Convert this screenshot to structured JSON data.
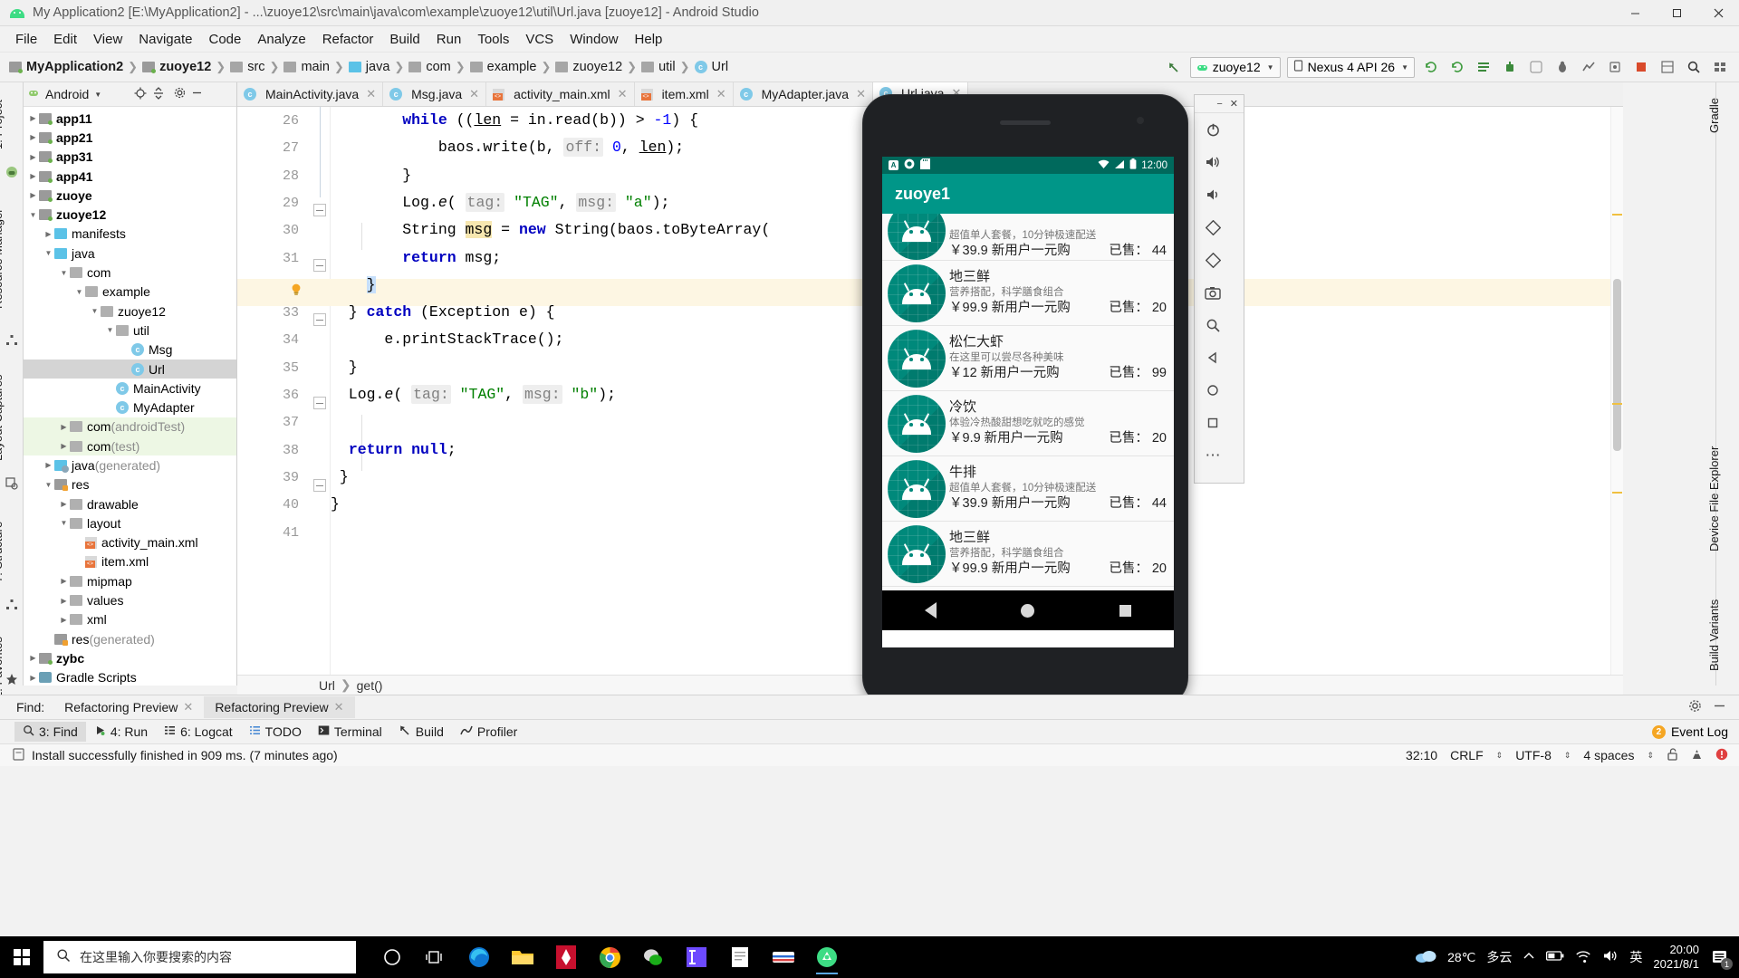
{
  "titlebar": {
    "title": "My Application2 [E:\\MyApplication2] - ...\\zuoye12\\src\\main\\java\\com\\example\\zuoye12\\util\\Url.java [zuoye12] - Android Studio",
    "minimize": "–",
    "maximize": "▢",
    "close": "✕"
  },
  "menu": [
    "File",
    "Edit",
    "View",
    "Navigate",
    "Code",
    "Analyze",
    "Refactor",
    "Build",
    "Run",
    "Tools",
    "VCS",
    "Window",
    "Help"
  ],
  "breadcrumb": [
    {
      "label": "MyApplication2",
      "icon": "module-folder-icon",
      "bold": true
    },
    {
      "label": "zuoye12",
      "icon": "module-folder-icon",
      "bold": true
    },
    {
      "label": "src",
      "icon": "folder-icon",
      "bold": false
    },
    {
      "label": "main",
      "icon": "folder-icon",
      "bold": false
    },
    {
      "label": "java",
      "icon": "source-folder-icon",
      "bold": false
    },
    {
      "label": "com",
      "icon": "package-icon",
      "bold": false
    },
    {
      "label": "example",
      "icon": "package-icon",
      "bold": false
    },
    {
      "label": "zuoye12",
      "icon": "package-icon",
      "bold": false
    },
    {
      "label": "util",
      "icon": "package-icon",
      "bold": false
    },
    {
      "label": "Url",
      "icon": "java-class-icon",
      "bold": false
    }
  ],
  "toolbar": {
    "run_config": "zuoye12",
    "device": "Nexus 4 API 26",
    "icons": [
      "back-arrow-icon",
      "sync-icon",
      "sync-project-icon",
      "avd-manager-icon",
      "sdk-manager-icon",
      "run-icon",
      "debug-icon",
      "profile-icon",
      "attach-debugger-icon",
      "stop-icon",
      "layout-inspector-icon",
      "search-everywhere-icon",
      "project-structure-icon"
    ]
  },
  "left_rail": [
    "1: Project",
    "Resource Manager",
    "Layout Captures",
    "7: Structure",
    "2: Favorites"
  ],
  "right_rail": [
    "Gradle",
    "Device File Explorer",
    "Build Variants"
  ],
  "project_panel": {
    "selector": "Android",
    "header_icons": [
      "locate-icon",
      "collapse-all-icon",
      "settings-icon",
      "hide-icon"
    ],
    "tree": [
      {
        "label": "app11",
        "depth": 0,
        "arrow": "collapsed",
        "icon": "module-folder-icon",
        "bold": true
      },
      {
        "label": "app21",
        "depth": 0,
        "arrow": "collapsed",
        "icon": "module-folder-icon",
        "bold": true
      },
      {
        "label": "app31",
        "depth": 0,
        "arrow": "collapsed",
        "icon": "module-folder-icon",
        "bold": true
      },
      {
        "label": "app41",
        "depth": 0,
        "arrow": "collapsed",
        "icon": "module-folder-icon",
        "bold": true
      },
      {
        "label": "zuoye",
        "depth": 0,
        "arrow": "collapsed",
        "icon": "module-folder-icon",
        "bold": true
      },
      {
        "label": "zuoye12",
        "depth": 0,
        "arrow": "expanded",
        "icon": "module-folder-icon",
        "bold": true
      },
      {
        "label": "manifests",
        "depth": 1,
        "arrow": "collapsed",
        "icon": "source-folder-icon",
        "bold": false
      },
      {
        "label": "java",
        "depth": 1,
        "arrow": "expanded",
        "icon": "source-folder-icon",
        "bold": false
      },
      {
        "label": "com",
        "depth": 2,
        "arrow": "expanded",
        "icon": "package-icon",
        "bold": false
      },
      {
        "label": "example",
        "depth": 3,
        "arrow": "expanded",
        "icon": "package-icon",
        "bold": false
      },
      {
        "label": "zuoye12",
        "depth": 4,
        "arrow": "expanded",
        "icon": "package-icon",
        "bold": false
      },
      {
        "label": "util",
        "depth": 5,
        "arrow": "expanded",
        "icon": "package-icon",
        "bold": false
      },
      {
        "label": "Msg",
        "depth": 6,
        "arrow": "none",
        "icon": "java-class-icon",
        "bold": false
      },
      {
        "label": "Url",
        "depth": 6,
        "arrow": "none",
        "icon": "java-class-icon",
        "bold": false,
        "selected": true
      },
      {
        "label": "MainActivity",
        "depth": 5,
        "arrow": "none",
        "icon": "java-class-icon",
        "bold": false
      },
      {
        "label": "MyAdapter",
        "depth": 5,
        "arrow": "none",
        "icon": "java-class-icon",
        "bold": false
      },
      {
        "label": "com",
        "suffix": " (androidTest)",
        "depth": 2,
        "arrow": "collapsed",
        "icon": "package-icon",
        "bold": false,
        "test": true
      },
      {
        "label": "com",
        "suffix": " (test)",
        "depth": 2,
        "arrow": "collapsed",
        "icon": "package-icon",
        "bold": false,
        "test": true
      },
      {
        "label": "java",
        "suffix": " (generated)",
        "depth": 1,
        "arrow": "collapsed",
        "icon": "generated-folder-icon",
        "bold": false
      },
      {
        "label": "res",
        "depth": 1,
        "arrow": "expanded",
        "icon": "res-folder-icon",
        "bold": false
      },
      {
        "label": "drawable",
        "depth": 2,
        "arrow": "collapsed",
        "icon": "package-icon",
        "bold": false
      },
      {
        "label": "layout",
        "depth": 2,
        "arrow": "expanded",
        "icon": "package-icon",
        "bold": false
      },
      {
        "label": "activity_main.xml",
        "depth": 3,
        "arrow": "none",
        "icon": "xml-layout-icon",
        "bold": false
      },
      {
        "label": "item.xml",
        "depth": 3,
        "arrow": "none",
        "icon": "xml-layout-icon",
        "bold": false
      },
      {
        "label": "mipmap",
        "depth": 2,
        "arrow": "collapsed",
        "icon": "package-icon",
        "bold": false
      },
      {
        "label": "values",
        "depth": 2,
        "arrow": "collapsed",
        "icon": "package-icon",
        "bold": false
      },
      {
        "label": "xml",
        "depth": 2,
        "arrow": "collapsed",
        "icon": "package-icon",
        "bold": false
      },
      {
        "label": "res",
        "suffix": " (generated)",
        "depth": 1,
        "arrow": "none",
        "icon": "res-folder-icon",
        "bold": false
      },
      {
        "label": "zybc",
        "depth": 0,
        "arrow": "collapsed",
        "icon": "module-folder-icon",
        "bold": true
      },
      {
        "label": "Gradle Scripts",
        "depth": 0,
        "arrow": "collapsed",
        "icon": "gradle-icon",
        "bold": false
      }
    ]
  },
  "editor": {
    "tabs": [
      {
        "label": "MainActivity.java",
        "icon": "java-class-icon",
        "active": false
      },
      {
        "label": "Msg.java",
        "icon": "java-class-icon",
        "active": false
      },
      {
        "label": "activity_main.xml",
        "icon": "xml-layout-icon",
        "active": false
      },
      {
        "label": "item.xml",
        "icon": "xml-layout-icon",
        "active": false
      },
      {
        "label": "MyAdapter.java",
        "icon": "java-class-icon",
        "active": false
      },
      {
        "label": "Url.java",
        "icon": "java-class-icon",
        "active": true
      }
    ],
    "first_line_number": 26,
    "line_numbers": [
      26,
      27,
      28,
      29,
      30,
      31,
      32,
      33,
      34,
      35,
      36,
      37,
      38,
      39,
      40,
      41
    ],
    "highlight_line": 32,
    "breadcrumb": [
      "Url",
      "get()"
    ],
    "code_lines": [
      {
        "n": 26,
        "html": "        <span class=\"kw\">while</span> ((<span class=\"ul\">len</span> = in.read(b)) &gt; <span class=\"num\">-1</span>) {"
      },
      {
        "n": 27,
        "html": "            baos.write(b, <span class=\"hint\">off:</span> <span class=\"num\">0</span>, <span class=\"ul\">len</span>);"
      },
      {
        "n": 28,
        "html": "        }"
      },
      {
        "n": 29,
        "html": "        Log.<span class=\"ital\">e</span>( <span class=\"hint\">tag:</span> <span class=\"str\">\"TAG\"</span>, <span class=\"hint\">msg:</span> <span class=\"str\">\"a\"</span>);"
      },
      {
        "n": 30,
        "html": "        String <span class=\"occur\">msg</span> = <span class=\"kw\">new</span> String(baos.toByteArray("
      },
      {
        "n": 31,
        "html": "        <span class=\"kw\">return</span> msg;"
      },
      {
        "n": 32,
        "html": "    <span class=\"caretsel\">}</span>"
      },
      {
        "n": 33,
        "html": "  } <span class=\"kw\">catch</span> (Exception e) {"
      },
      {
        "n": 34,
        "html": "      e.printStackTrace();"
      },
      {
        "n": 35,
        "html": "  }"
      },
      {
        "n": 36,
        "html": "  Log.<span class=\"ital\">e</span>( <span class=\"hint\">tag:</span> <span class=\"str\">\"TAG\"</span>, <span class=\"hint\">msg:</span> <span class=\"str\">\"b\"</span>);"
      },
      {
        "n": 37,
        "html": ""
      },
      {
        "n": 38,
        "html": "  <span class=\"kw\">return</span> <span class=\"kw\">null</span>;"
      },
      {
        "n": 39,
        "html": " }"
      },
      {
        "n": 40,
        "html": "}"
      },
      {
        "n": 41,
        "html": ""
      }
    ]
  },
  "emulator": {
    "window_icons": [
      "minimize-icon",
      "close-icon",
      "power-icon",
      "volume-up-icon",
      "volume-down-icon",
      "rotate-left-icon",
      "rotate-right-icon",
      "screenshot-icon",
      "zoom-icon",
      "back-icon",
      "home-icon",
      "overview-icon",
      "more-icon"
    ],
    "status_bar": {
      "left_icons": [
        "alarm-icon",
        "record-icon",
        "sdcard-icon"
      ],
      "wifi": "wifi-icon",
      "signal": "signal-icon",
      "battery": "battery-icon",
      "time": "12:00"
    },
    "app_title": "zuoye1",
    "list_items": [
      {
        "title": "",
        "desc": "超值单人套餐，10分钟极速配送",
        "price": "￥39.9 新用户一元购",
        "sold": "已售： 44",
        "partial": true
      },
      {
        "title": "地三鲜",
        "desc": "营养搭配，科学膳食组合",
        "price": "￥99.9 新用户一元购",
        "sold": "已售： 20"
      },
      {
        "title": "松仁大虾",
        "desc": "在这里可以尝尽各种美味",
        "price": "￥12 新用户一元购",
        "sold": "已售： 99"
      },
      {
        "title": "冷饮",
        "desc": "体验冷热酸甜想吃就吃的感觉",
        "price": "￥9.9 新用户一元购",
        "sold": "已售： 20"
      },
      {
        "title": "牛排",
        "desc": "超值单人套餐，10分钟极速配送",
        "price": "￥39.9 新用户一元购",
        "sold": "已售： 44"
      },
      {
        "title": "地三鲜",
        "desc": "营养搭配，科学膳食组合",
        "price": "￥99.9 新用户一元购",
        "sold": "已售： 20"
      }
    ],
    "nav_buttons": [
      "back-button",
      "home-button",
      "recents-button"
    ]
  },
  "find_panel": {
    "label": "Find:",
    "tabs": [
      {
        "label": "Refactoring Preview",
        "active": false
      },
      {
        "label": "Refactoring Preview",
        "active": true
      }
    ],
    "right_icons": [
      "settings-icon",
      "hide-icon"
    ]
  },
  "tool_windows": [
    {
      "label": "3: Find",
      "icon": "search-icon",
      "active": true
    },
    {
      "label": "4: Run",
      "icon": "run-icon",
      "active": false
    },
    {
      "label": "6: Logcat",
      "icon": "logcat-icon",
      "active": false
    },
    {
      "label": "TODO",
      "icon": "todo-icon",
      "active": false
    },
    {
      "label": "Terminal",
      "icon": "terminal-icon",
      "active": false
    },
    {
      "label": "Build",
      "icon": "build-icon",
      "active": false
    },
    {
      "label": "Profiler",
      "icon": "profiler-icon",
      "active": false
    }
  ],
  "event_log": {
    "label": "Event Log",
    "badge": "2"
  },
  "status_bar": {
    "message": "Install successfully finished in 909 ms. (7 minutes ago)",
    "message_icon": "info-icon",
    "caret": "32:10",
    "line_sep": "CRLF",
    "encoding": "UTF-8",
    "indent": "4 spaces",
    "lock_icon": "unlock-icon",
    "inspect_icon": "inspection-icon",
    "error_icon": "error-icon"
  },
  "taskbar": {
    "start_icon": "windows-start-icon",
    "search_placeholder": "在这里输入你要搜索的内容",
    "search_icon": "search-icon",
    "apps": [
      {
        "name": "cortana-icon"
      },
      {
        "name": "task-view-icon"
      },
      {
        "name": "edge-icon"
      },
      {
        "name": "file-explorer-icon"
      },
      {
        "name": "red-app-icon"
      },
      {
        "name": "chrome-icon"
      },
      {
        "name": "wechat-icon"
      },
      {
        "name": "intellij-icon"
      },
      {
        "name": "notepad-icon"
      },
      {
        "name": "browser-icon"
      },
      {
        "name": "android-studio-icon",
        "active": true
      }
    ],
    "weather": {
      "icon": "cloud-icon",
      "temp": "28℃",
      "desc": "多云"
    },
    "tray_icons": [
      "chevron-up-icon",
      "battery-icon",
      "wifi-icon",
      "volume-icon"
    ],
    "ime": "英",
    "time": "20:00",
    "date": "2021/8/1",
    "notification_icon": "notification-icon",
    "notification_count": "1"
  },
  "colors": {
    "accent": "#009688",
    "status_bar_dark": "#00695c",
    "tab_active": "#4a89c8",
    "highlight_line": "#fdf6e3",
    "selection": "#c6dffb",
    "occurrence": "#f7e7b0"
  }
}
